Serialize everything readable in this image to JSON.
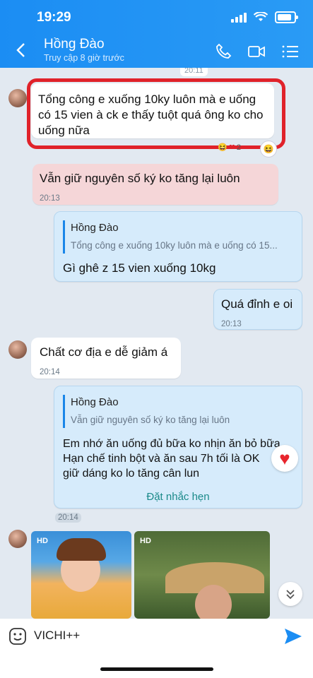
{
  "status": {
    "time": "19:29"
  },
  "header": {
    "name": "Hồng Đào",
    "last_seen": "Truy cập 8 giờ trước"
  },
  "top_partial_time": "20:11",
  "messages": {
    "m1": {
      "text": "Tổng công  e xuống 10ky luôn  mà  e uống có 15 vien à ck e thấy tuột quá ông  ko cho uống nữa",
      "reactions": "2"
    },
    "m2": {
      "text": "Vẫn giữ  nguyên số ký  ko tăng lại luôn",
      "time": "20:13"
    },
    "m3": {
      "quote_name": "Hồng Đào",
      "quote_text": "Tổng công  e xuống 10ky luôn  mà  e uống có 15...",
      "text": "Gì ghê z 15 vien xuống 10kg"
    },
    "m4": {
      "text": "Quá đỉnh e oi",
      "time": "20:13"
    },
    "m5": {
      "text": "Chất  cơ địa e dễ giảm á",
      "time": "20:14"
    },
    "m6": {
      "quote_name": "Hồng Đào",
      "quote_text": "Vẫn giữ  nguyên số ký  ko tăng lại luôn",
      "lines": [
        "Em nhớ ăn uống đủ bữa ko nhịn ăn bỏ bữa",
        "Hạn chế tinh bột và ăn sau 7h tối là OK",
        "giữ dáng ko lo tăng cân lun"
      ],
      "reminder": "Đặt nhắc hẹn",
      "time": "20:14"
    },
    "images": {
      "hd1": "HD",
      "hd2": "HD"
    }
  },
  "composer": {
    "text": "VICHI++"
  },
  "colors": {
    "header": "#1b8df3",
    "highlight": "#e0222a",
    "bubble_me": "#d6ebfb"
  }
}
